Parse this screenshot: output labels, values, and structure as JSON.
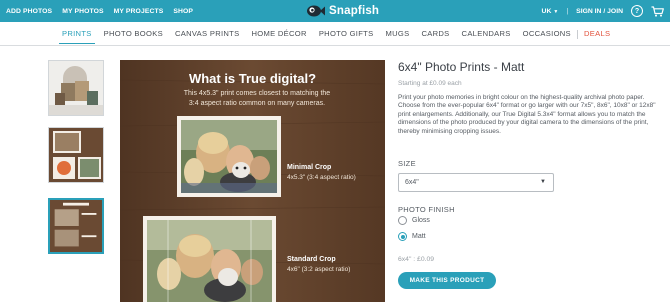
{
  "topbar": {
    "links": [
      "ADD PHOTOS",
      "MY PHOTOS",
      "MY PROJECTS",
      "SHOP"
    ],
    "brand": "Snapfish",
    "region": "UK",
    "signin": "SIGN IN / JOIN",
    "help_icon": "question-circle-icon",
    "cart_icon": "cart-icon",
    "color": "#2aa0b9"
  },
  "nav": {
    "items": [
      "PRINTS",
      "PHOTO BOOKS",
      "CANVAS PRINTS",
      "HOME DÉCOR",
      "PHOTO GIFTS",
      "MUGS",
      "CARDS",
      "CALENDARS",
      "OCCASIONS",
      "DEALS"
    ],
    "active": "PRINTS",
    "deals_color": "#e2533e"
  },
  "gallery": {
    "thumbnails": [
      "print-stack-thumbnail",
      "photos-on-wood-thumbnail",
      "true-digital-thumbnail"
    ],
    "selected_index": 2
  },
  "main_image": {
    "title": "What is True digital?",
    "subtitle": "This 4x5.3\" print comes closest to matching the 3:4 aspect ratio common on many cameras.",
    "crop1_label": "Minimal Crop",
    "crop1_ratio": "4x5.3\" (3:4 aspect ratio)",
    "crop2_label": "Standard Crop",
    "crop2_ratio": "4x6\" (3:2 aspect ratio)"
  },
  "product": {
    "title": "6x4\" Photo Prints - Matt",
    "starting": "Starting at £0.09 each",
    "description": "Print your photo memories in bright colour on the highest-quality archival photo paper. Choose from the ever-popular 6x4\" format or go larger with our 7x5\", 8x6\", 10x8\" or 12x8\" print enlargements. Additionally, our True Digital 5.3x4\" format allows you to match the dimensions of the photo produced by your digital camera to the dimensions of the print, thereby minimising cropping issues.",
    "size_label": "SIZE",
    "size_value": "6x4\"",
    "finish_label": "PHOTO FINISH",
    "finish_options": [
      "Gloss",
      "Matt"
    ],
    "finish_selected": "Matt",
    "price_line": "6x4\" : £0.09",
    "cta": "MAKE THIS PRODUCT"
  }
}
